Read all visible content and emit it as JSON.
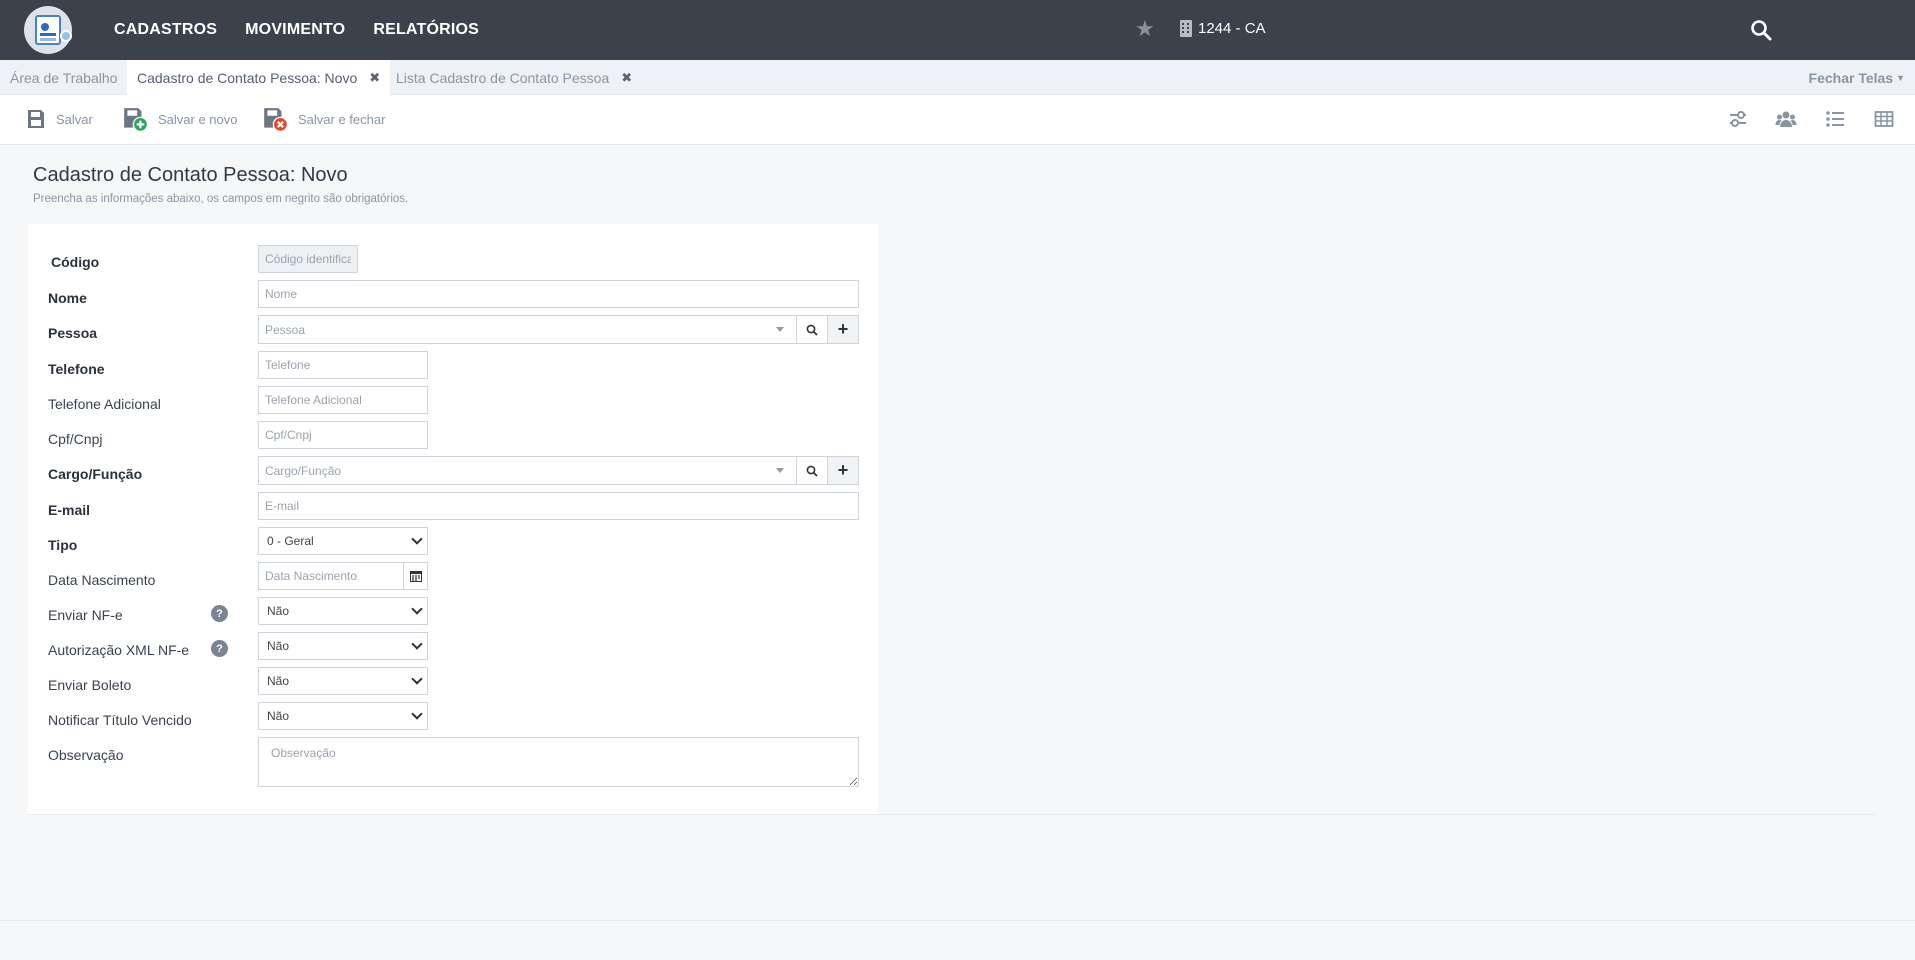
{
  "topbar": {
    "menu": [
      "CADASTROS",
      "MOVIMENTO",
      "RELATÓRIOS"
    ],
    "company": "1244 - CA"
  },
  "tabs": {
    "items": [
      {
        "label": "Área de Trabalho"
      },
      {
        "label": "Cadastro de Contato Pessoa: Novo"
      },
      {
        "label": "Lista Cadastro de Contato Pessoa"
      }
    ],
    "close_all": "Fechar Telas"
  },
  "toolbar": {
    "save": "Salvar",
    "save_new": "Salvar e novo",
    "save_close": "Salvar e fechar"
  },
  "page": {
    "title": "Cadastro de Contato Pessoa: Novo",
    "subtitle": "Preencha as informações abaixo, os campos em negrito são obrigatórios."
  },
  "form": {
    "codigo": {
      "label": "Código",
      "placeholder": "Código identificador"
    },
    "nome": {
      "label": "Nome",
      "placeholder": "Nome"
    },
    "pessoa": {
      "label": "Pessoa",
      "placeholder": "Pessoa"
    },
    "telefone": {
      "label": "Telefone",
      "placeholder": "Telefone"
    },
    "telefone_adicional": {
      "label": "Telefone Adicional",
      "placeholder": "Telefone Adicional"
    },
    "cpf_cnpj": {
      "label": "Cpf/Cnpj",
      "placeholder": "Cpf/Cnpj"
    },
    "cargo": {
      "label": "Cargo/Função",
      "placeholder": "Cargo/Função"
    },
    "email": {
      "label": "E-mail",
      "placeholder": "E-mail"
    },
    "tipo": {
      "label": "Tipo",
      "value": "0 - Geral"
    },
    "data_nascimento": {
      "label": "Data Nascimento",
      "placeholder": "Data Nascimento"
    },
    "enviar_nfe": {
      "label": "Enviar NF-e",
      "value": "Não"
    },
    "autorizacao_xml": {
      "label": "Autorização XML NF-e",
      "value": "Não"
    },
    "enviar_boleto": {
      "label": "Enviar Boleto",
      "value": "Não"
    },
    "notificar_titulo": {
      "label": "Notificar Título Vencido",
      "value": "Não"
    },
    "observacao": {
      "label": "Observação",
      "placeholder": "Observação"
    }
  },
  "colors": {
    "navbar": "#3b424c",
    "page_bg": "#f6f7f8",
    "tab_strip": "#eef2f6"
  }
}
